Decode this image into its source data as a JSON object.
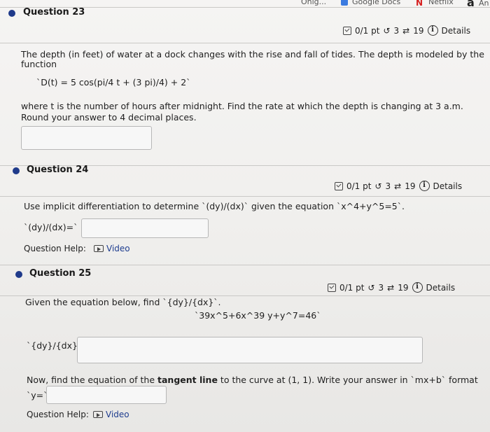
{
  "bookmarks": {
    "truncated": "Onig...",
    "google_docs": "Google Docs",
    "netflix": "Netflix",
    "amazon_mark": "a",
    "amazon_text": "An"
  },
  "q23": {
    "title": "Question 23",
    "score": "0/1 pt",
    "tries": "3",
    "retries": "19",
    "details": "Details",
    "line1": "The depth (in feet) of water at a dock changes with the rise and fall of tides. The depth is modeled by the",
    "line2": "function",
    "formula": "`D(t) = 5 cos(pi/4 t + (3 pi)/4) + 2`",
    "line3": "where t is the number of hours after midnight. Find the rate at which the depth is changing at 3 a.m.",
    "line4": "Round your answer to 4 decimal places.",
    "answer": ""
  },
  "q24": {
    "title": "Question 24",
    "score": "0/1 pt",
    "tries": "3",
    "retries": "19",
    "details": "Details",
    "prompt": "Use implicit differentiation to determine `(dy)/(dx)` given the equation `x^4+y^5=5`.",
    "label": "`(dy)/(dx)=`",
    "answer": "",
    "help_label": "Question Help:",
    "video": "Video"
  },
  "q25": {
    "title": "Question 25",
    "score": "0/1 pt",
    "tries": "3",
    "retries": "19",
    "details": "Details",
    "prompt": "Given the equation below, find `{dy}/{dx}`.",
    "equation": "`39x^5+6x^39 y+y^7=46`",
    "label1": "`{dy}/{dx}=`",
    "answer1": "",
    "tangent_pre": "Now, find the equation of the",
    "tangent_bold": "tangent line",
    "tangent_post": "to the curve at (1, 1). Write your answer in `mx+b` format",
    "label2": "`y=`",
    "answer2": "",
    "help_label": "Question Help:",
    "video": "Video"
  }
}
